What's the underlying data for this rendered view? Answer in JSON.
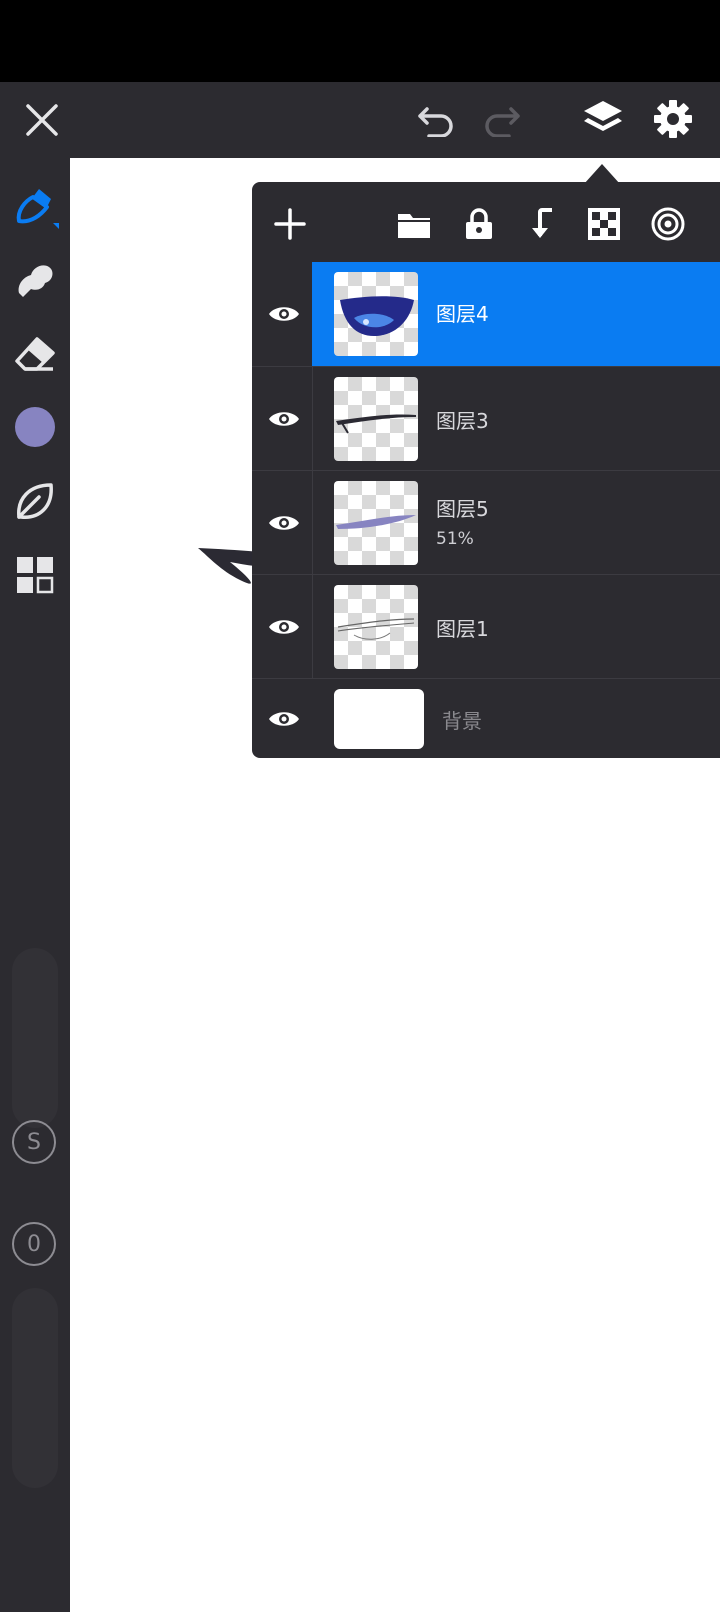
{
  "topbar": {
    "close_icon": "close-icon",
    "undo_icon": "undo-icon",
    "redo_icon": "redo-icon",
    "layers_icon": "layers-icon",
    "settings_icon": "gear-icon"
  },
  "sidebar": {
    "tools": [
      "brush-tool-icon",
      "smudge-tool-icon",
      "eraser-tool-icon",
      "color-swatch",
      "leaf-tool-icon",
      "grid-tool-icon"
    ],
    "current_color": "#8784c1",
    "size_button": "S",
    "opacity_button": "0"
  },
  "layers_panel": {
    "toolbar": [
      "add-icon",
      "folder-icon",
      "lock-icon",
      "merge-down-icon",
      "alpha-lock-icon",
      "mask-icon"
    ],
    "layers": [
      {
        "name": "图层4",
        "opacity": "",
        "selected": true
      },
      {
        "name": "图层3",
        "opacity": "",
        "selected": false
      },
      {
        "name": "图层5",
        "opacity": "51%",
        "selected": false
      },
      {
        "name": "图层1",
        "opacity": "",
        "selected": false
      },
      {
        "name": "背景",
        "opacity": "",
        "selected": false
      }
    ]
  },
  "colors": {
    "accent": "#0a7cf2",
    "panel": "#2c2b30",
    "statusbar": "#000000"
  }
}
